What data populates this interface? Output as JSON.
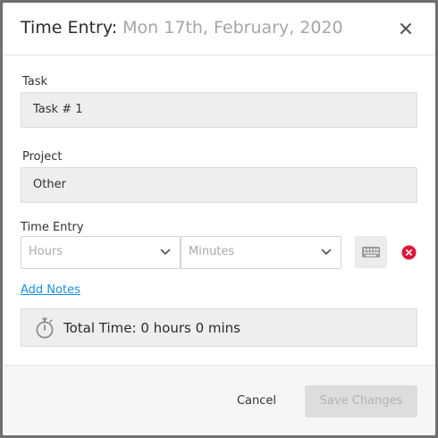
{
  "dialog": {
    "title": "Time Entry:",
    "date": "Mon 17th, February, 2020"
  },
  "task": {
    "label": "Task",
    "value": "Task # 1"
  },
  "project": {
    "label": "Project",
    "value": "Other"
  },
  "time_entry": {
    "label": "Time Entry",
    "hours_placeholder": "Hours",
    "minutes_placeholder": "Minutes"
  },
  "add_notes": "Add Notes",
  "total_time": "Total Time: 0 hours 0 mins",
  "footer": {
    "cancel": "Cancel",
    "save": "Save Changes"
  },
  "icons": {
    "close": "close-icon",
    "chevron": "chevron-down-icon",
    "keyboard": "keyboard-icon",
    "remove": "remove-circle-icon",
    "stopwatch": "stopwatch-icon"
  },
  "colors": {
    "link": "#1a8fe0",
    "remove": "#e0163d",
    "field_bg": "#eeeeee",
    "save_disabled_bg": "#dddddd"
  }
}
